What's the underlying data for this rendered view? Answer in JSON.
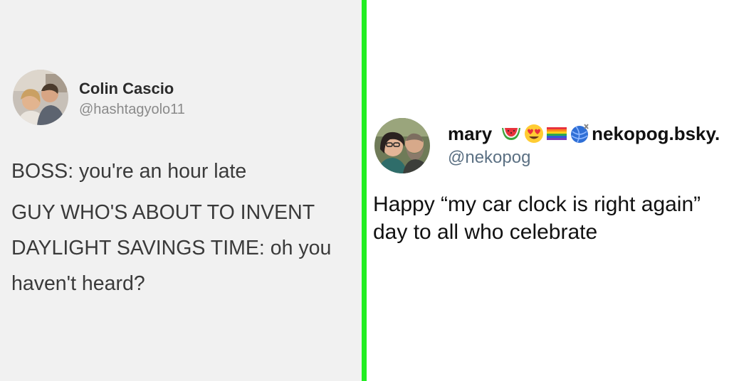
{
  "colors": {
    "left_background": "#f1f1f1",
    "divider": "#22ee22",
    "right_background": "#ffffff",
    "handle_gray": "#8a8a8a",
    "handle_blue_gray": "#5b7083"
  },
  "left_tweet": {
    "name": "Colin Cascio",
    "handle": "@hashtagyolo11",
    "avatar_icon": "profile-photo-two-people",
    "body_line_1": "BOSS: you're an hour late",
    "body_line_2": "GUY WHO'S ABOUT TO INVENT DAYLIGHT SAVINGS TIME: oh you haven't heard?"
  },
  "right_tweet": {
    "name": "mary",
    "name_emojis": [
      "watermelon-icon",
      "heart-eyes-icon",
      "rainbow-flag-icon",
      "yarn-ball-icon"
    ],
    "name_suffix": "nekopog.bsky.",
    "handle": "@nekopog",
    "avatar_icon": "profile-photo-two-people",
    "body": "Happy “my car clock is right again” day to all who celebrate"
  }
}
